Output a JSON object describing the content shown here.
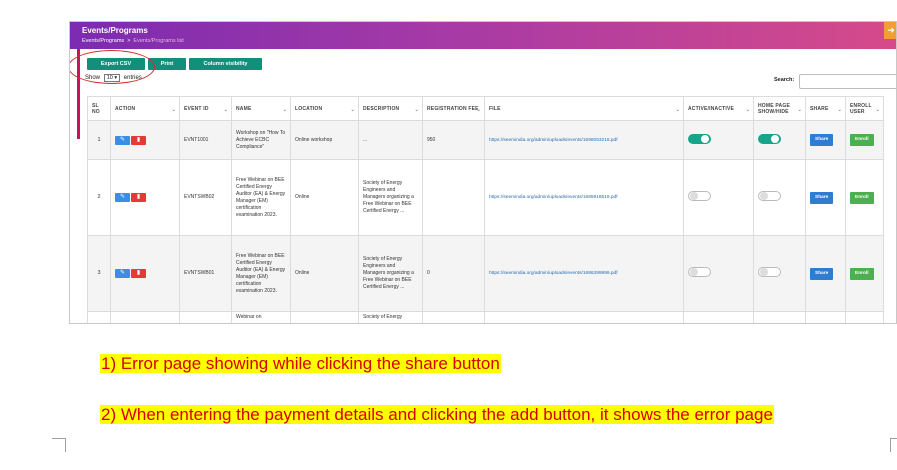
{
  "header": {
    "title": "Events/Programs",
    "breadcrumb": [
      "Events/Programs",
      "Events/Programs list"
    ],
    "breadcrumb_sep": ">",
    "corner_icon": "arrow-right-icon"
  },
  "toolbar": {
    "export_label": "Export CSV",
    "print_label": "Print",
    "colvis_label": "Column visibility",
    "show_label": "Show",
    "show_value": "10",
    "entries_label": "entries",
    "search_label": "Search:"
  },
  "table": {
    "columns": [
      "SL NO",
      "ACTION",
      "EVENT ID",
      "NAME",
      "LOCATION",
      "DESCRIPTION",
      "REGISTRATION FEE",
      "FILE",
      "ACTIVE/INACTIVE",
      "HOME PAGE SHOW/HIDE",
      "SHARE",
      "ENROLL USER"
    ],
    "rows": [
      {
        "sl": "1",
        "event_id": "EVNT1001",
        "name": "Workshop on \"How To Achieve ECBC Compliance\"",
        "location": "Online workshop",
        "description": "...",
        "fee": "950",
        "file": "https://seemindia.org/admin/uploads/events/1696053216.pdf",
        "active": true,
        "home": true,
        "share_label": "Share",
        "enroll_label": "Enroll"
      },
      {
        "sl": "2",
        "event_id": "EVNTSWB02",
        "name": "Free Webinar on BEE Certified Energy Auditor (EA) & Energy Manager (EM) certification examination 2023.",
        "location": "Online",
        "description": "Society of Energy Engineers and Managers organizing a Free Webinar on BEE Certified Energy ...",
        "fee": "",
        "file": "https://seemindia.org/admin/uploads/events/1685918519.pdf",
        "active": false,
        "home": false,
        "share_label": "Share",
        "enroll_label": "Enroll"
      },
      {
        "sl": "3",
        "event_id": "EVNTSWB01",
        "name": "Free Webinar on BEE Certified Energy Auditor (EA) & Energy Manager (EM) certification examination 2023.",
        "location": "Online",
        "description": "Society of Energy Engineers and Managers organizing a Free Webinar on BEE Certified Energy ...",
        "fee": "0",
        "file": "https://seemindia.org/admin/uploads/events/1686399999.pdf",
        "active": false,
        "home": false,
        "share_label": "Share",
        "enroll_label": "Enroll"
      }
    ],
    "partial_row": {
      "name": "Webinar on",
      "description": "Society of Energy"
    }
  },
  "notes": [
    "1)   Error page showing while clicking the share button",
    "2)   When entering the payment details and clicking the add button, it shows the error page"
  ],
  "colors": {
    "banner_start": "#7b2bb0",
    "banner_end": "#d64a8a",
    "button_green": "#128f7a",
    "share_blue": "#2f7dd1",
    "enroll_green": "#4caf50",
    "note_red": "#d50000",
    "highlight": "#ffff00",
    "annotation_circle": "#d32f2f"
  }
}
